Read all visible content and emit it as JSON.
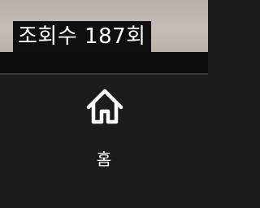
{
  "video": {
    "view_count_text": "조회수 187회"
  },
  "bottom_nav": {
    "items": [
      {
        "label": "홈",
        "icon": "home-icon",
        "selected": true
      }
    ]
  },
  "colors": {
    "nav_background": "#1c1c1c",
    "text": "#ffffff"
  }
}
